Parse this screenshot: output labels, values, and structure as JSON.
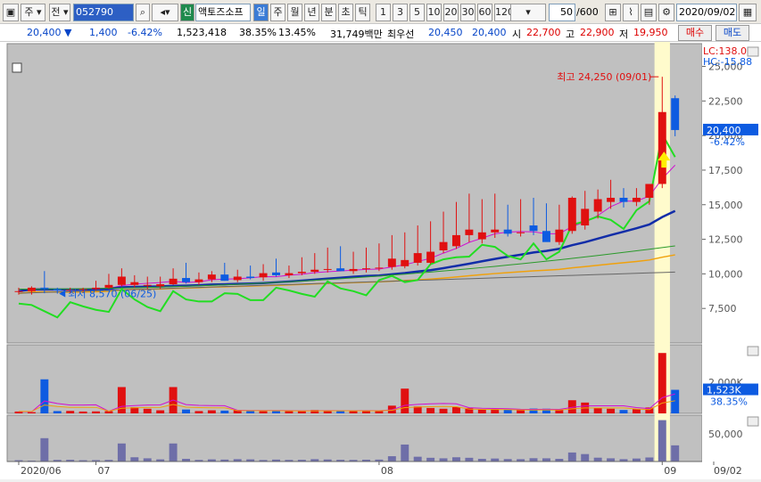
{
  "toolbar": {
    "market": "주",
    "period_type": "전",
    "code": "052790",
    "badge": "신",
    "stock_name": "액토즈소프",
    "periods": [
      "일",
      "주",
      "월",
      "년",
      "분",
      "초",
      "틱"
    ],
    "intervals": [
      "1",
      "3",
      "5",
      "10",
      "20",
      "30",
      "60",
      "120"
    ],
    "bars": "50",
    "bars_total": "/600",
    "date": "2020/09/02"
  },
  "quote": {
    "price": "20,400 ▼",
    "change": "1,400",
    "change_pct": "-6.42%",
    "volume": "1,523,418",
    "vol_ratio": "38.35%",
    "turnover": "13.45%",
    "amount": "31,749백만",
    "best_label": "최우선",
    "ask": "20,450",
    "bid": "20,400",
    "open_label": "시",
    "open": "22,700",
    "high_label": "고",
    "high": "22,900",
    "low_label": "저",
    "low": "19,950",
    "buy": "매수",
    "sell": "매도"
  },
  "chart": {
    "lc": "LC:138.04",
    "hc": "HC:-15.88",
    "price_ticks": [
      "25,000",
      "22,500",
      "20,000",
      "17,500",
      "15,000",
      "12,500",
      "10,000",
      "7,500"
    ],
    "current_price": "20,400",
    "current_pct": "-6.42%",
    "high_note": "최고 24,250 (09/01)",
    "low_note": "최저 8,570 (06/25)",
    "vol_ticks": [
      "2,000K"
    ],
    "vol_current": "1,523K",
    "vol_pct": "38.35%",
    "amt_ticks": [
      "50,000"
    ],
    "dates": [
      "2020/06",
      "07",
      "08",
      "09",
      "09/02"
    ]
  },
  "colors": {
    "up": "#e01010",
    "down": "#0d5be1",
    "ma5": "#d10fd1",
    "ma20": "#122da8",
    "ma60": "#f0a10c",
    "ma120": "#2a9a2a",
    "ma240": "#666666",
    "osc": "#22dd22",
    "highlight": "#fffbcc",
    "volbar": "#6e6ea8"
  },
  "chart_data": {
    "type": "candlestick",
    "x": [
      "06/22",
      "06/23",
      "06/24",
      "06/25",
      "06/26",
      "06/29",
      "06/30",
      "07/01",
      "07/02",
      "07/03",
      "07/06",
      "07/07",
      "07/08",
      "07/09",
      "07/10",
      "07/13",
      "07/14",
      "07/15",
      "07/16",
      "07/17",
      "07/20",
      "07/21",
      "07/22",
      "07/23",
      "07/24",
      "07/27",
      "07/28",
      "07/29",
      "07/30",
      "07/31",
      "08/03",
      "08/04",
      "08/05",
      "08/06",
      "08/07",
      "08/10",
      "08/11",
      "08/12",
      "08/13",
      "08/14",
      "08/18",
      "08/19",
      "08/20",
      "08/21",
      "08/24",
      "08/25",
      "08/26",
      "08/27",
      "08/28",
      "08/31",
      "09/01",
      "09/02"
    ],
    "open": [
      8700,
      8750,
      9000,
      8900,
      8800,
      8850,
      8900,
      9000,
      9200,
      9200,
      9150,
      9100,
      9250,
      9700,
      9400,
      9600,
      9950,
      9550,
      9800,
      9750,
      10100,
      9900,
      10050,
      10150,
      10300,
      10400,
      10200,
      10350,
      10400,
      10500,
      10550,
      10800,
      10800,
      11700,
      12000,
      12800,
      12500,
      13000,
      13200,
      13000,
      13500,
      13100,
      12300,
      13100,
      13500,
      14500,
      15200,
      15500,
      15200,
      15500,
      16500,
      22700
    ],
    "high": [
      9000,
      9100,
      10200,
      9000,
      9000,
      9000,
      9500,
      10000,
      10400,
      9900,
      9800,
      9800,
      10400,
      10800,
      10100,
      10200,
      10800,
      10300,
      10600,
      10700,
      11100,
      10600,
      11200,
      11500,
      11900,
      12000,
      11600,
      11900,
      12200,
      12800,
      13000,
      13500,
      13800,
      14500,
      15200,
      15800,
      15400,
      15800,
      15000,
      15400,
      15500,
      15100,
      15000,
      15600,
      16000,
      16100,
      16800,
      16200,
      16200,
      16200,
      24250,
      22900
    ],
    "low": [
      8500,
      8500,
      8600,
      8570,
      8600,
      8700,
      8800,
      8900,
      9100,
      9000,
      8900,
      8900,
      9200,
      9300,
      9200,
      9400,
      9500,
      9400,
      9600,
      9500,
      9800,
      9700,
      9900,
      10000,
      10100,
      10200,
      10000,
      10100,
      10200,
      10300,
      10400,
      10600,
      10700,
      11500,
      11800,
      12300,
      12200,
      12600,
      12700,
      12700,
      12800,
      12800,
      12100,
      12900,
      13200,
      14000,
      14700,
      14800,
      14900,
      15000,
      16200,
      19950
    ],
    "close": [
      8750,
      9000,
      8900,
      8800,
      8850,
      8900,
      9000,
      9200,
      9800,
      9400,
      9200,
      9250,
      9650,
      9400,
      9600,
      9950,
      9500,
      9800,
      9700,
      10050,
      9900,
      10050,
      10150,
      10300,
      10350,
      10200,
      10350,
      10400,
      10450,
      11100,
      11000,
      11500,
      11600,
      12300,
      12800,
      13200,
      13000,
      13200,
      12900,
      13000,
      13100,
      12300,
      13200,
      15500,
      14700,
      15400,
      15500,
      15200,
      15500,
      16500,
      21700,
      20400
    ],
    "volume": [
      120,
      80,
      2200,
      150,
      160,
      120,
      130,
      150,
      1700,
      400,
      300,
      200,
      1700,
      250,
      150,
      200,
      180,
      220,
      200,
      140,
      180,
      150,
      160,
      220,
      190,
      160,
      150,
      170,
      180,
      500,
      1600,
      450,
      350,
      300,
      400,
      350,
      250,
      280,
      230,
      220,
      310,
      300,
      250,
      850,
      700,
      360,
      300,
      220,
      280,
      380,
      3900,
      1523
    ],
    "ylim": [
      5000,
      26000
    ]
  }
}
